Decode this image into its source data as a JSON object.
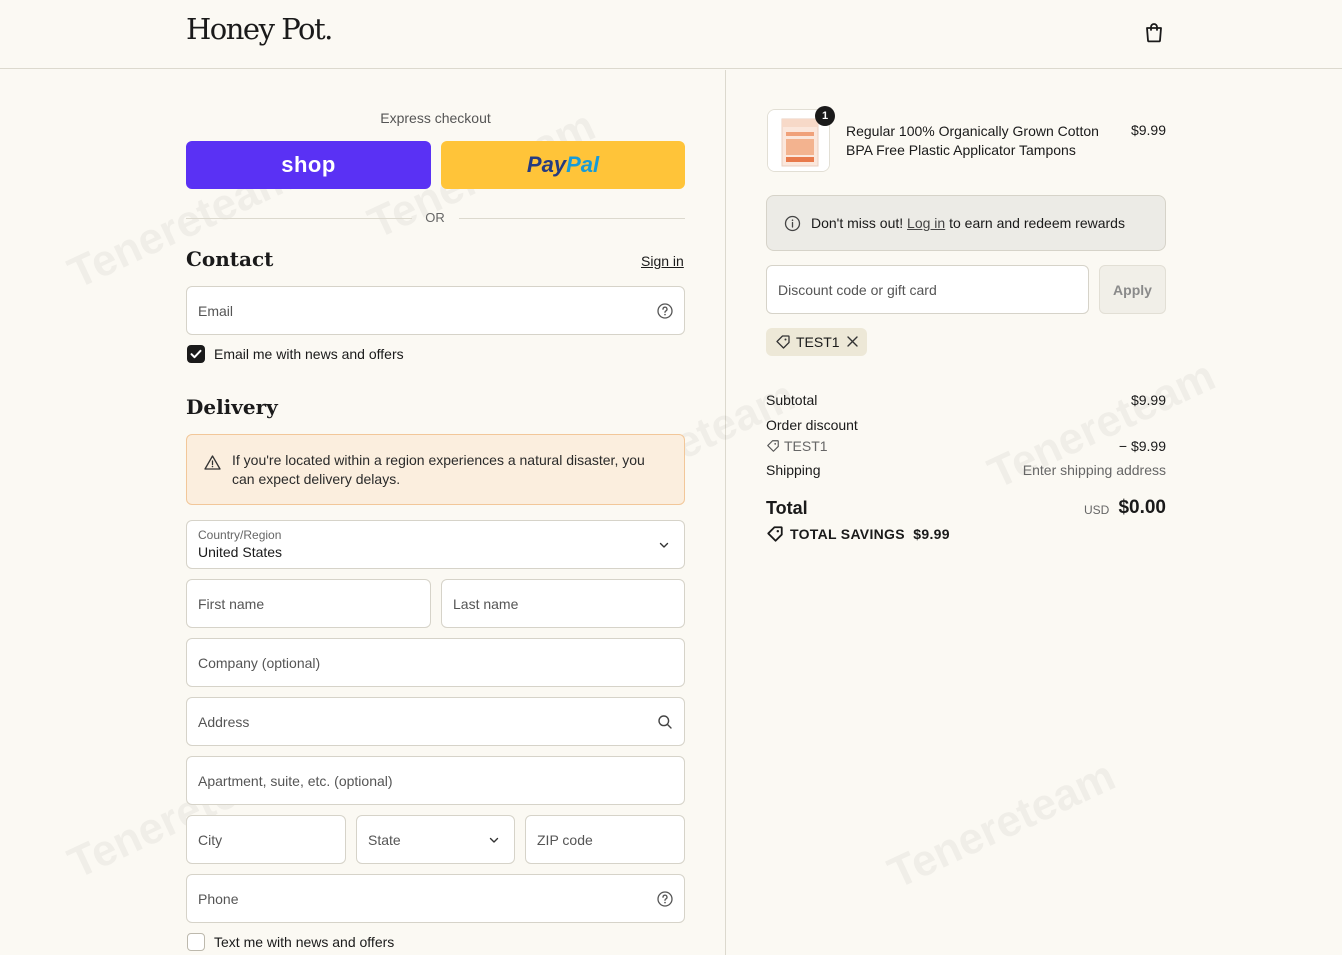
{
  "header": {
    "brand": "Honey Pot.",
    "cart_icon": "shopping-bag-icon"
  },
  "express": {
    "title": "Express checkout",
    "shop_label": "shop",
    "paypal_label_1": "Pay",
    "paypal_label_2": "Pal",
    "or_label": "OR"
  },
  "contact": {
    "title": "Contact",
    "sign_in": "Sign in",
    "email_placeholder": "Email",
    "news_label": "Email me with news and offers",
    "news_checked": true
  },
  "delivery": {
    "title": "Delivery",
    "notice": "If you're located within a region experiences a natural disaster, you can expect delivery delays.",
    "country_label": "Country/Region",
    "country_value": "United States",
    "first_name": "First name",
    "last_name": "Last name",
    "company": "Company (optional)",
    "address": "Address",
    "apartment": "Apartment, suite, etc. (optional)",
    "city": "City",
    "state": "State",
    "zip": "ZIP code",
    "phone": "Phone",
    "sms_label": "Text me with news and offers",
    "sms_checked": false
  },
  "order": {
    "product": {
      "name": "Regular 100% Organically Grown Cotton BPA Free Plastic Applicator Tampons",
      "price": "$9.99",
      "quantity": "1"
    },
    "rewards": {
      "prefix": "Don't miss out! ",
      "link": "Log in",
      "suffix": " to earn and redeem rewards"
    },
    "discount_placeholder": "Discount code or gift card",
    "apply_label": "Apply",
    "applied_code": "TEST1",
    "subtotal_label": "Subtotal",
    "subtotal_value": "$9.99",
    "order_discount_label": "Order discount",
    "discount_code": "TEST1",
    "discount_value": "− $9.99",
    "shipping_label": "Shipping",
    "shipping_value": "Enter shipping address",
    "total_label": "Total",
    "currency": "USD",
    "total_value": "$0.00",
    "savings_label": "TOTAL SAVINGS",
    "savings_value": "$9.99"
  },
  "colors": {
    "shop": "#5a31f4",
    "paypal": "#ffc439",
    "background": "#fbf9f3",
    "notice_bg": "#fbeede"
  }
}
